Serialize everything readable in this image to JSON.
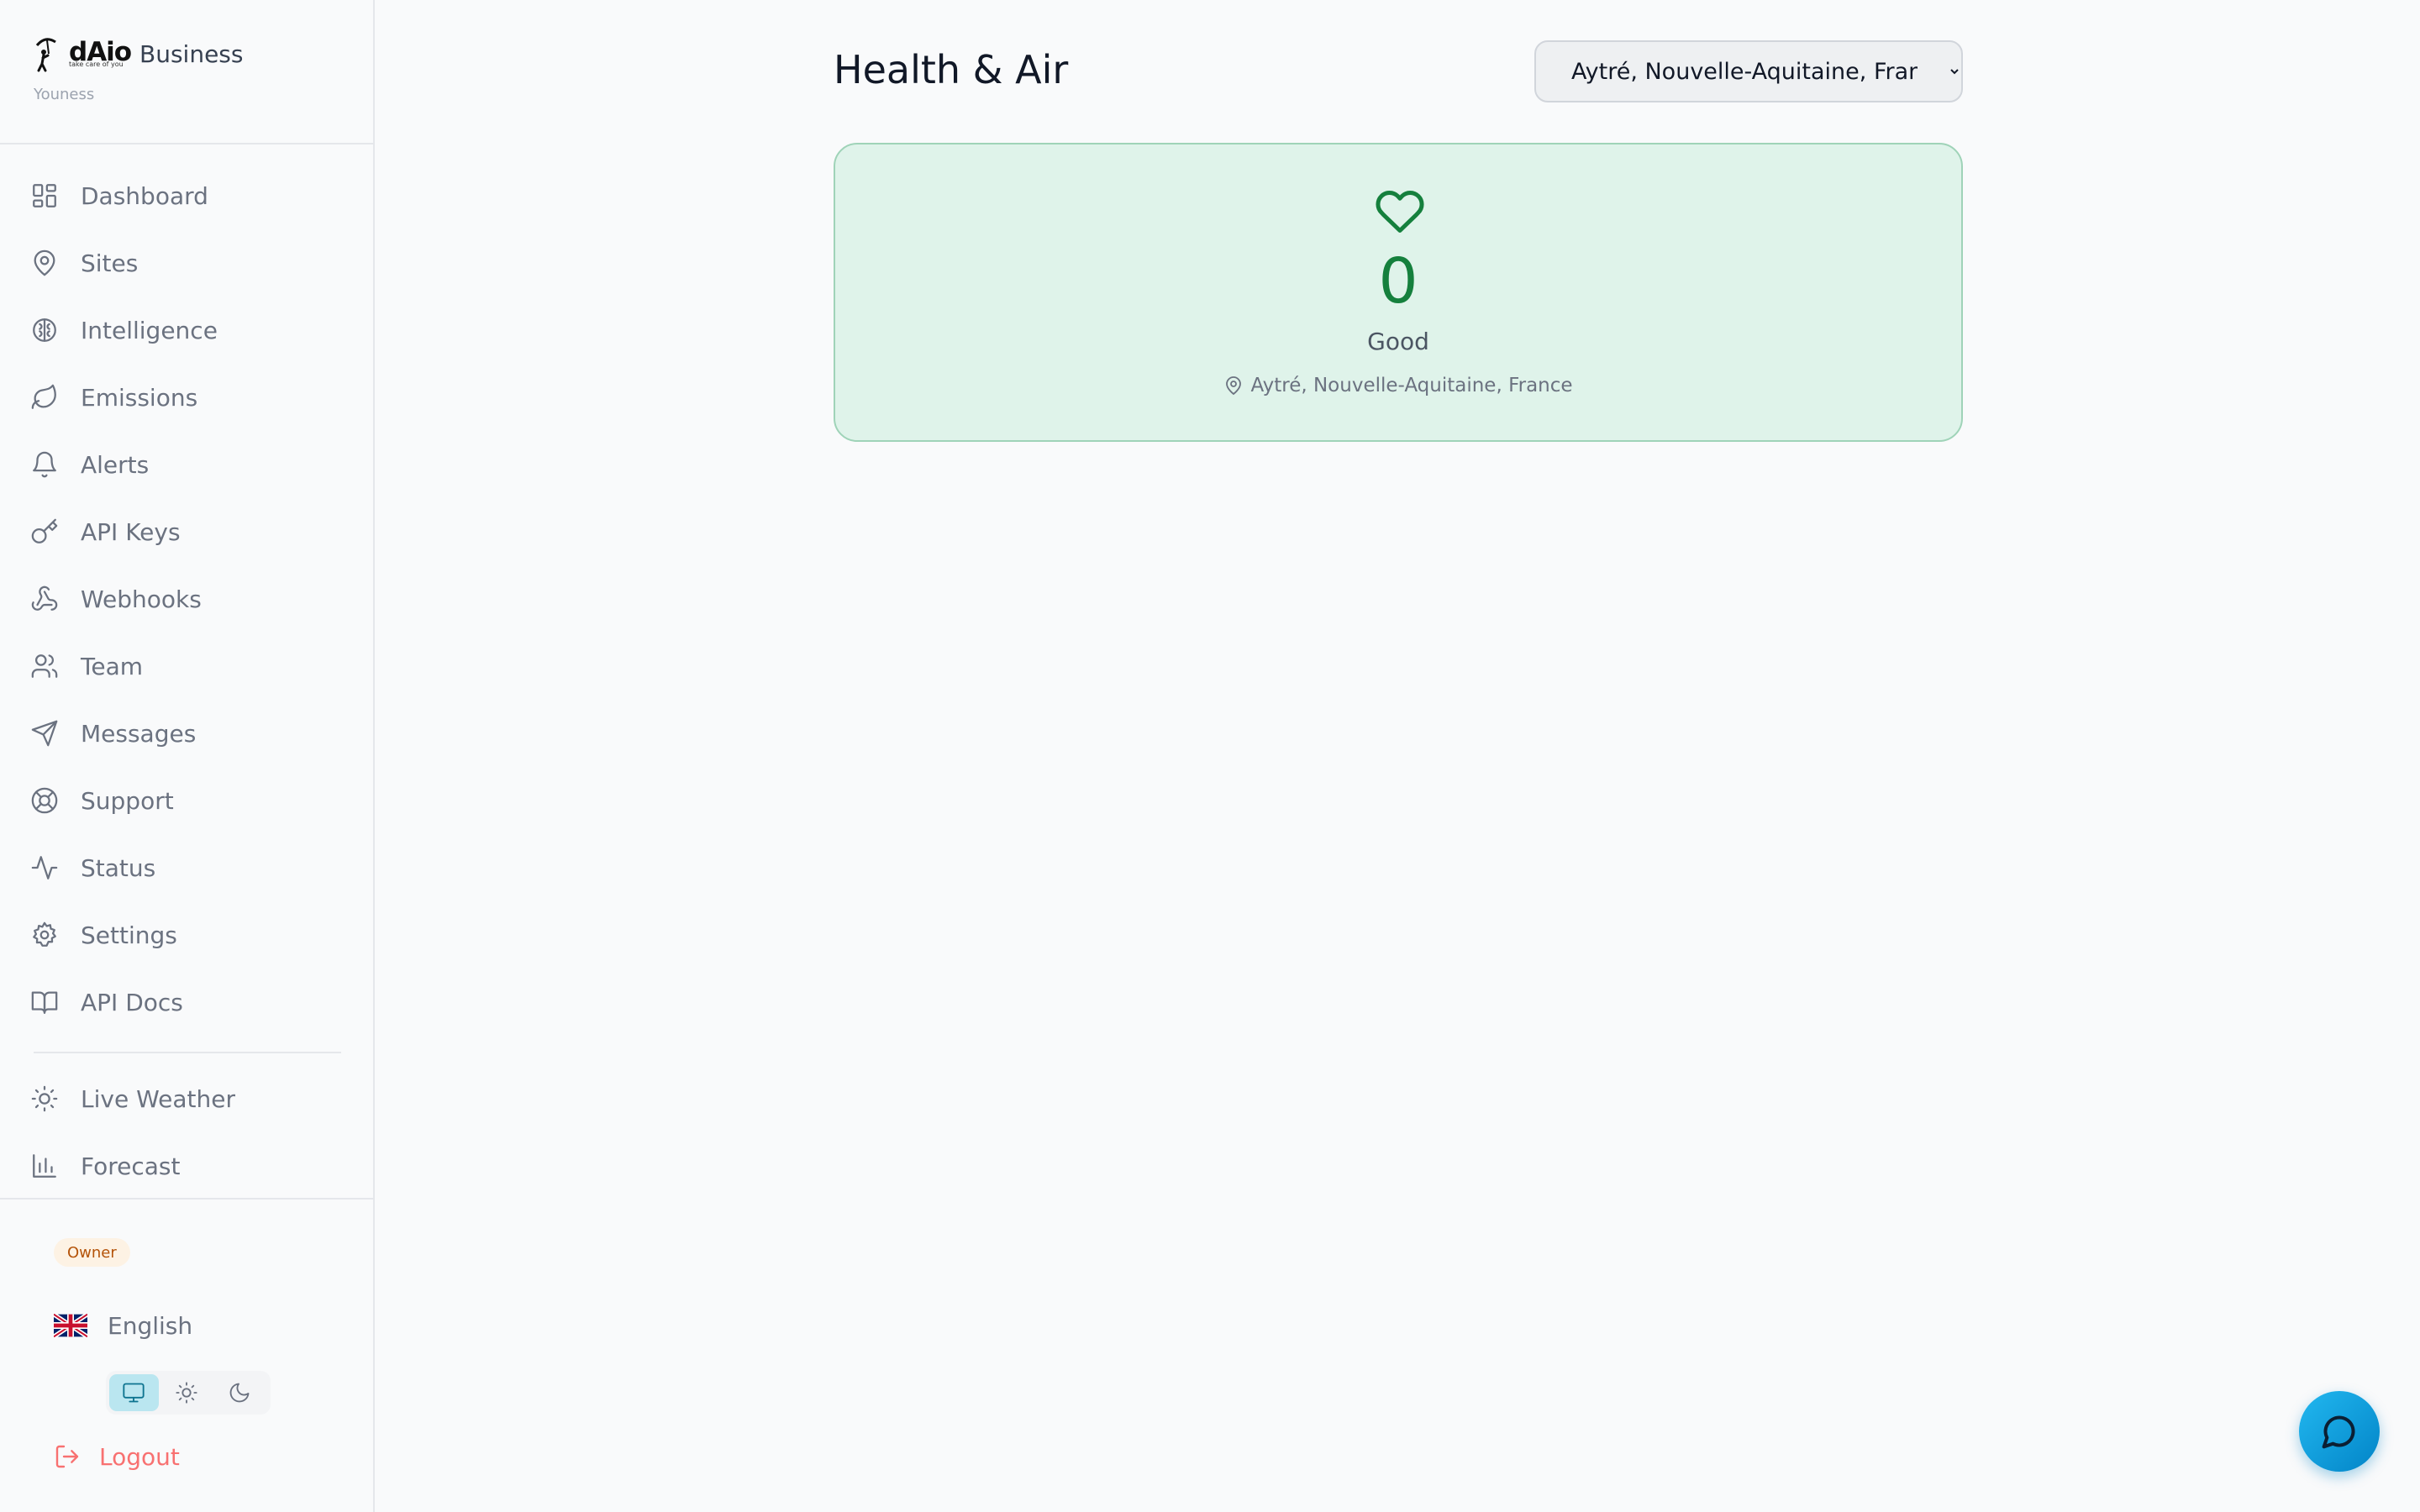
{
  "brand": {
    "logo_text": "dAio",
    "logo_tagline": "take care of you",
    "product": "Business",
    "user": "Youness"
  },
  "nav": {
    "items": [
      {
        "label": "Dashboard",
        "icon": "dashboard-icon"
      },
      {
        "label": "Sites",
        "icon": "map-pin-icon"
      },
      {
        "label": "Intelligence",
        "icon": "brain-icon"
      },
      {
        "label": "Emissions",
        "icon": "leaf-icon"
      },
      {
        "label": "Alerts",
        "icon": "bell-icon"
      },
      {
        "label": "API Keys",
        "icon": "key-icon"
      },
      {
        "label": "Webhooks",
        "icon": "webhook-icon"
      },
      {
        "label": "Team",
        "icon": "users-icon"
      },
      {
        "label": "Messages",
        "icon": "send-icon"
      },
      {
        "label": "Support",
        "icon": "life-buoy-icon"
      },
      {
        "label": "Status",
        "icon": "activity-icon"
      },
      {
        "label": "Settings",
        "icon": "gear-icon"
      },
      {
        "label": "API Docs",
        "icon": "book-icon"
      }
    ],
    "extra_items": [
      {
        "label": "Live Weather",
        "icon": "sun-icon"
      },
      {
        "label": "Forecast",
        "icon": "bar-chart-icon"
      }
    ]
  },
  "footer": {
    "role_badge": "Owner",
    "language": "English",
    "theme": {
      "options": [
        "system",
        "light",
        "dark"
      ],
      "selected": "system"
    },
    "logout": "Logout"
  },
  "main": {
    "title": "Health & Air",
    "location_select": {
      "value": "Aytré, Nouvelle-Aquitaine, France",
      "options": [
        "Aytré, Nouvelle-Aquitaine, France"
      ]
    },
    "aqi_card": {
      "value": "0",
      "label": "Good",
      "location": "Aytré, Nouvelle-Aquitaine, France",
      "accent_color": "#15803d",
      "background_color": "#dff3ea"
    }
  },
  "chat_button": {
    "icon": "chat-bubble-icon",
    "color": "#0ea5e9"
  }
}
